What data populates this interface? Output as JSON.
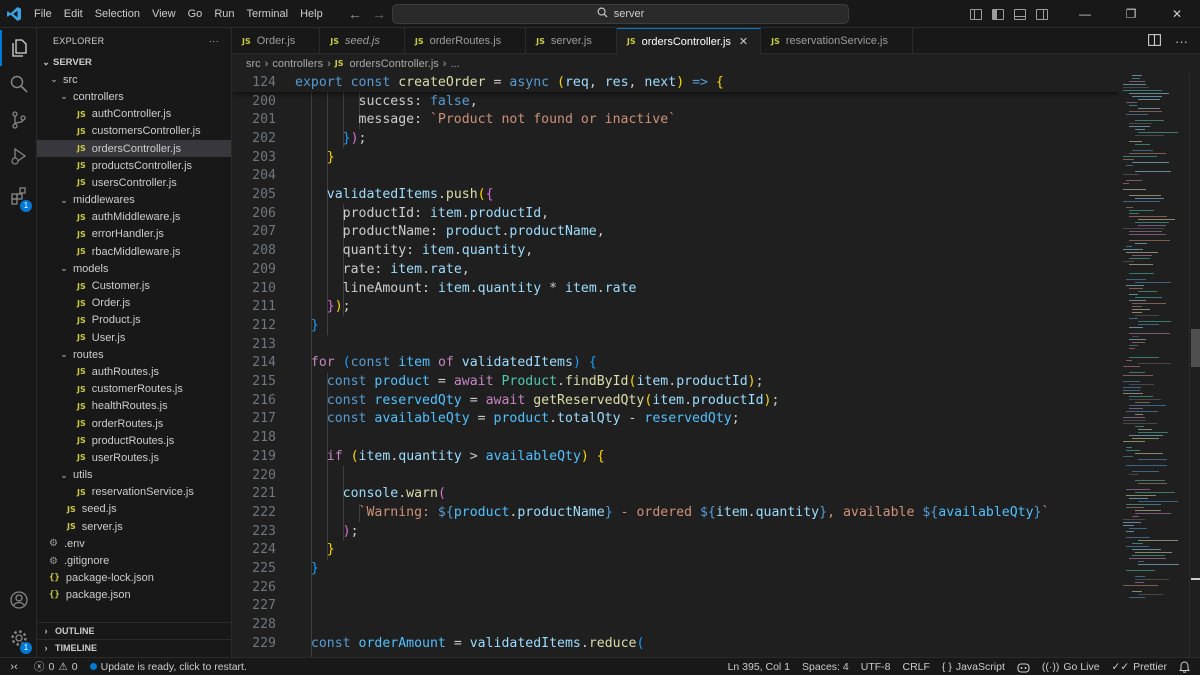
{
  "menu": [
    "File",
    "Edit",
    "Selection",
    "View",
    "Go",
    "Run",
    "Terminal",
    "Help"
  ],
  "search": {
    "text": "server"
  },
  "explorer": {
    "title": "EXPLORER",
    "more": "···",
    "root": "SERVER",
    "tree": [
      {
        "depth": 0,
        "type": "folder",
        "label": "src"
      },
      {
        "depth": 1,
        "type": "folder",
        "label": "controllers"
      },
      {
        "depth": 2,
        "type": "js",
        "label": "authController.js"
      },
      {
        "depth": 2,
        "type": "js",
        "label": "customersController.js"
      },
      {
        "depth": 2,
        "type": "js",
        "label": "ordersController.js",
        "selected": true
      },
      {
        "depth": 2,
        "type": "js",
        "label": "productsController.js"
      },
      {
        "depth": 2,
        "type": "js",
        "label": "usersController.js"
      },
      {
        "depth": 1,
        "type": "folder",
        "label": "middlewares"
      },
      {
        "depth": 2,
        "type": "js",
        "label": "authMiddleware.js"
      },
      {
        "depth": 2,
        "type": "js",
        "label": "errorHandler.js"
      },
      {
        "depth": 2,
        "type": "js",
        "label": "rbacMiddleware.js"
      },
      {
        "depth": 1,
        "type": "folder",
        "label": "models"
      },
      {
        "depth": 2,
        "type": "js",
        "label": "Customer.js"
      },
      {
        "depth": 2,
        "type": "js",
        "label": "Order.js"
      },
      {
        "depth": 2,
        "type": "js",
        "label": "Product.js"
      },
      {
        "depth": 2,
        "type": "js",
        "label": "User.js"
      },
      {
        "depth": 1,
        "type": "folder",
        "label": "routes"
      },
      {
        "depth": 2,
        "type": "js",
        "label": "authRoutes.js"
      },
      {
        "depth": 2,
        "type": "js",
        "label": "customerRoutes.js"
      },
      {
        "depth": 2,
        "type": "js",
        "label": "healthRoutes.js"
      },
      {
        "depth": 2,
        "type": "js",
        "label": "orderRoutes.js"
      },
      {
        "depth": 2,
        "type": "js",
        "label": "productRoutes.js"
      },
      {
        "depth": 2,
        "type": "js",
        "label": "userRoutes.js"
      },
      {
        "depth": 1,
        "type": "folder",
        "label": "utils"
      },
      {
        "depth": 2,
        "type": "js",
        "label": "reservationService.js"
      },
      {
        "depth": 1,
        "type": "js",
        "label": "seed.js"
      },
      {
        "depth": 1,
        "type": "js",
        "label": "server.js"
      },
      {
        "depth": 0,
        "type": "env",
        "label": ".env"
      },
      {
        "depth": 0,
        "type": "env",
        "label": ".gitignore"
      },
      {
        "depth": 0,
        "type": "json",
        "label": "package-lock.json"
      },
      {
        "depth": 0,
        "type": "json",
        "label": "package.json"
      }
    ],
    "outline": "OUTLINE",
    "timeline": "TIMELINE"
  },
  "tabs": [
    {
      "label": "Order.js",
      "active": false,
      "italic": false
    },
    {
      "label": "seed.js",
      "active": false,
      "italic": true
    },
    {
      "label": "orderRoutes.js",
      "active": false,
      "italic": false
    },
    {
      "label": "server.js",
      "active": false,
      "italic": false
    },
    {
      "label": "ordersController.js",
      "active": true,
      "italic": false
    },
    {
      "label": "reservationService.js",
      "active": false,
      "italic": false
    }
  ],
  "breadcrumb": [
    "src",
    "controllers",
    "ordersController.js",
    "..."
  ],
  "js_badge": "JS",
  "activity_badge": "1",
  "code": [
    {
      "n": "124",
      "sticky": true,
      "t": [
        [
          "export const ",
          "kw"
        ],
        [
          "createOrder",
          "fn"
        ],
        [
          " = ",
          ""
        ],
        [
          "async ",
          "kw"
        ],
        [
          "(",
          "br1"
        ],
        [
          "req",
          "var"
        ],
        [
          ", ",
          ""
        ],
        [
          "res",
          "var"
        ],
        [
          ", ",
          ""
        ],
        [
          "next",
          "var"
        ],
        [
          ")",
          "br1"
        ],
        [
          " => ",
          "kw"
        ],
        [
          "{",
          "br1"
        ]
      ]
    },
    {
      "n": "200",
      "t": [
        [
          "        success",
          ""
        ],
        [
          ": ",
          ""
        ],
        [
          "false",
          "kw"
        ],
        [
          ",",
          ""
        ]
      ]
    },
    {
      "n": "201",
      "t": [
        [
          "        message",
          ""
        ],
        [
          ": ",
          ""
        ],
        [
          "`Product not found or inactive`",
          "str"
        ]
      ]
    },
    {
      "n": "202",
      "t": [
        [
          "      ",
          ""
        ],
        [
          "}",
          "br3"
        ],
        [
          ")",
          "br2"
        ],
        [
          ";",
          ""
        ]
      ]
    },
    {
      "n": "203",
      "t": [
        [
          "    ",
          ""
        ],
        [
          "}",
          "br1"
        ]
      ]
    },
    {
      "n": "204",
      "t": []
    },
    {
      "n": "205",
      "t": [
        [
          "    validatedItems",
          "var"
        ],
        [
          ".",
          ""
        ],
        [
          "push",
          "fn"
        ],
        [
          "(",
          "br1"
        ],
        [
          "{",
          "br2"
        ]
      ]
    },
    {
      "n": "206",
      "t": [
        [
          "      productId",
          ""
        ],
        [
          ": ",
          ""
        ],
        [
          "item",
          "var"
        ],
        [
          ".",
          ""
        ],
        [
          "productId",
          "prop"
        ],
        [
          ",",
          ""
        ]
      ]
    },
    {
      "n": "207",
      "t": [
        [
          "      productName",
          ""
        ],
        [
          ": ",
          ""
        ],
        [
          "product",
          "var"
        ],
        [
          ".",
          ""
        ],
        [
          "productName",
          "prop"
        ],
        [
          ",",
          ""
        ]
      ]
    },
    {
      "n": "208",
      "t": [
        [
          "      quantity",
          ""
        ],
        [
          ": ",
          ""
        ],
        [
          "item",
          "var"
        ],
        [
          ".",
          ""
        ],
        [
          "quantity",
          "prop"
        ],
        [
          ",",
          ""
        ]
      ]
    },
    {
      "n": "209",
      "t": [
        [
          "      rate",
          ""
        ],
        [
          ": ",
          ""
        ],
        [
          "item",
          "var"
        ],
        [
          ".",
          ""
        ],
        [
          "rate",
          "prop"
        ],
        [
          ",",
          ""
        ]
      ]
    },
    {
      "n": "210",
      "t": [
        [
          "      lineAmount",
          ""
        ],
        [
          ": ",
          ""
        ],
        [
          "item",
          "var"
        ],
        [
          ".",
          ""
        ],
        [
          "quantity",
          "prop"
        ],
        [
          " * ",
          ""
        ],
        [
          "item",
          "var"
        ],
        [
          ".",
          ""
        ],
        [
          "rate",
          "prop"
        ]
      ]
    },
    {
      "n": "211",
      "t": [
        [
          "    ",
          ""
        ],
        [
          "}",
          "br2"
        ],
        [
          ")",
          "br1"
        ],
        [
          ";",
          ""
        ]
      ]
    },
    {
      "n": "212",
      "t": [
        [
          "  ",
          ""
        ],
        [
          "}",
          "br3"
        ]
      ]
    },
    {
      "n": "213",
      "t": []
    },
    {
      "n": "214",
      "t": [
        [
          "  ",
          ""
        ],
        [
          "for ",
          "cf"
        ],
        [
          "(",
          "br3"
        ],
        [
          "const ",
          "kw"
        ],
        [
          "item",
          "cst"
        ],
        [
          " of ",
          "cf"
        ],
        [
          "validatedItems",
          "var"
        ],
        [
          ") ",
          "br3"
        ],
        [
          "{",
          "br3"
        ]
      ]
    },
    {
      "n": "215",
      "t": [
        [
          "    ",
          ""
        ],
        [
          "const ",
          "kw"
        ],
        [
          "product",
          "cst"
        ],
        [
          " = ",
          ""
        ],
        [
          "await ",
          "cf"
        ],
        [
          "Product",
          "cls"
        ],
        [
          ".",
          ""
        ],
        [
          "findById",
          "fn"
        ],
        [
          "(",
          "br1"
        ],
        [
          "item",
          "var"
        ],
        [
          ".",
          ""
        ],
        [
          "productId",
          "prop"
        ],
        [
          ")",
          "br1"
        ],
        [
          ";",
          ""
        ]
      ]
    },
    {
      "n": "216",
      "t": [
        [
          "    ",
          ""
        ],
        [
          "const ",
          "kw"
        ],
        [
          "reservedQty",
          "cst"
        ],
        [
          " = ",
          ""
        ],
        [
          "await ",
          "cf"
        ],
        [
          "getReservedQty",
          "fn"
        ],
        [
          "(",
          "br1"
        ],
        [
          "item",
          "var"
        ],
        [
          ".",
          ""
        ],
        [
          "productId",
          "prop"
        ],
        [
          ")",
          "br1"
        ],
        [
          ";",
          ""
        ]
      ]
    },
    {
      "n": "217",
      "t": [
        [
          "    ",
          ""
        ],
        [
          "const ",
          "kw"
        ],
        [
          "availableQty",
          "cst"
        ],
        [
          " = ",
          ""
        ],
        [
          "product",
          "cst"
        ],
        [
          ".",
          ""
        ],
        [
          "totalQty",
          "prop"
        ],
        [
          " - ",
          ""
        ],
        [
          "reservedQty",
          "cst"
        ],
        [
          ";",
          ""
        ]
      ]
    },
    {
      "n": "218",
      "t": []
    },
    {
      "n": "219",
      "t": [
        [
          "    ",
          ""
        ],
        [
          "if ",
          "cf"
        ],
        [
          "(",
          "br1"
        ],
        [
          "item",
          "var"
        ],
        [
          ".",
          ""
        ],
        [
          "quantity",
          "prop"
        ],
        [
          " > ",
          ""
        ],
        [
          "availableQty",
          "cst"
        ],
        [
          ") ",
          "br1"
        ],
        [
          "{",
          "br1"
        ]
      ]
    },
    {
      "n": "220",
      "t": []
    },
    {
      "n": "221",
      "t": [
        [
          "      console",
          "var"
        ],
        [
          ".",
          ""
        ],
        [
          "warn",
          "fn"
        ],
        [
          "(",
          "br2"
        ]
      ]
    },
    {
      "n": "222",
      "t": [
        [
          "        `Warning: ",
          "str"
        ],
        [
          "${",
          "kw"
        ],
        [
          "product",
          "cst"
        ],
        [
          ".",
          ""
        ],
        [
          "productName",
          "prop"
        ],
        [
          "}",
          "kw"
        ],
        [
          " - ordered ",
          "str"
        ],
        [
          "${",
          "kw"
        ],
        [
          "item",
          "var"
        ],
        [
          ".",
          ""
        ],
        [
          "quantity",
          "prop"
        ],
        [
          "}",
          "kw"
        ],
        [
          ", available ",
          "str"
        ],
        [
          "${",
          "kw"
        ],
        [
          "availableQty",
          "cst"
        ],
        [
          "}",
          "kw"
        ],
        [
          "`",
          "str"
        ]
      ]
    },
    {
      "n": "223",
      "t": [
        [
          "      ",
          ""
        ],
        [
          ")",
          "br2"
        ],
        [
          ";",
          ""
        ]
      ]
    },
    {
      "n": "224",
      "t": [
        [
          "    ",
          ""
        ],
        [
          "}",
          "br1"
        ]
      ]
    },
    {
      "n": "225",
      "t": [
        [
          "  ",
          ""
        ],
        [
          "}",
          "br3"
        ]
      ]
    },
    {
      "n": "226",
      "t": []
    },
    {
      "n": "227",
      "t": []
    },
    {
      "n": "228",
      "t": []
    },
    {
      "n": "229",
      "t": [
        [
          "  ",
          ""
        ],
        [
          "const ",
          "kw"
        ],
        [
          "orderAmount",
          "cst"
        ],
        [
          " = ",
          ""
        ],
        [
          "validatedItems",
          "var"
        ],
        [
          ".",
          ""
        ],
        [
          "reduce",
          "fn"
        ],
        [
          "(",
          "br3"
        ]
      ]
    }
  ],
  "status": {
    "errors": "0",
    "warnings": "0",
    "update": "Update is ready, click to restart.",
    "position": "Ln 395, Col 1",
    "spaces": "Spaces: 4",
    "encoding": "UTF-8",
    "eol": "CRLF",
    "language": "JavaScript",
    "golive": "Go Live",
    "prettier": "Prettier"
  },
  "colors": {
    "accent": "#0078d4",
    "js": "#cbcb41",
    "background": "#1f1f1f",
    "chrome": "#181818"
  }
}
